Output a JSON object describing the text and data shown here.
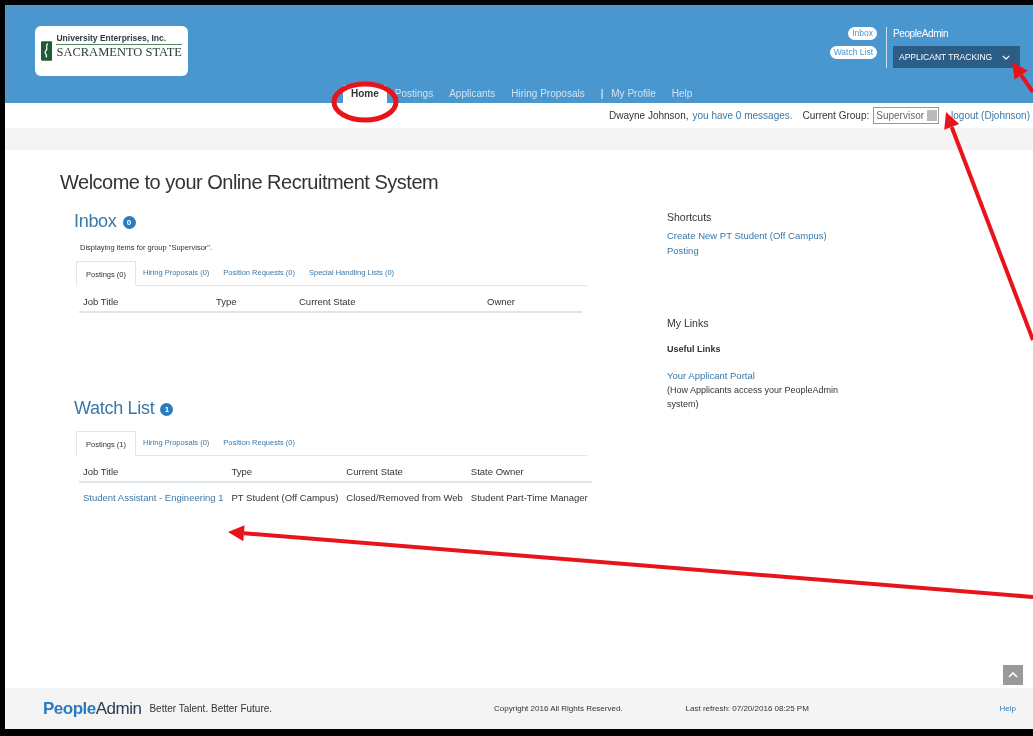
{
  "header": {
    "logo": {
      "line_1": "University Enterprises, Inc.",
      "line_2": "SACRAMENTO STATE"
    },
    "quick_links": [
      "Inbox",
      "Watch List"
    ],
    "product": "PeopleAdmin",
    "module_menu": "APPLICANT TRACKING",
    "nav": [
      {
        "kind": "tab",
        "label": "Home",
        "selected": true
      },
      {
        "kind": "tab",
        "label": "Postings",
        "selected": false
      },
      {
        "kind": "tab",
        "label": "Applicants",
        "selected": false
      },
      {
        "kind": "tab",
        "label": "Hiring Proposals",
        "selected": false
      },
      {
        "kind": "divider",
        "label": "|"
      },
      {
        "kind": "tab",
        "label": "My Profile",
        "selected": false
      },
      {
        "kind": "tab",
        "label": "Help",
        "selected": false
      }
    ]
  },
  "user_bar": {
    "user": "Dwayne Johnson,",
    "messages": "you have 0 messages.",
    "group_label": "Current Group:",
    "group_value": "Supervisor",
    "logout": "logout (Djohnson)"
  },
  "title": "Welcome to your Online Recruitment System",
  "inbox": {
    "title": "Inbox",
    "count": "0",
    "note": "Displaying items for group \"Supervisor\".",
    "tabs": [
      {
        "label": "Postings (0)",
        "selected": true
      },
      {
        "label": "Hiring Proposals (0)",
        "selected": false
      },
      {
        "label": "Position Requests (0)",
        "selected": false
      },
      {
        "label": "Special Handling Lists (0)",
        "selected": false
      }
    ],
    "columns": [
      "Job Title",
      "Type",
      "Current State",
      "Owner"
    ]
  },
  "watch_list": {
    "title": "Watch List",
    "count": "1",
    "tabs": [
      {
        "label": "Postings (1)",
        "selected": true
      },
      {
        "label": "Hiring Proposals (0)",
        "selected": false
      },
      {
        "label": "Position Requests (0)",
        "selected": false
      }
    ],
    "columns": [
      "Job Title",
      "Type",
      "Current State",
      "State Owner"
    ],
    "rows": [
      [
        "Student Assistant - Engineering 1",
        "PT Student (Off Campus)",
        "Closed/Removed from Web",
        "Student Part-Time Manager"
      ]
    ]
  },
  "shortcuts": {
    "title": "Shortcuts",
    "links": [
      "Create New PT Student (Off Campus) Posting"
    ]
  },
  "my_links": {
    "title": "My Links",
    "subtitle": "Useful Links",
    "link": "Your Applicant Portal",
    "note": "(How Applicants access your PeopleAdmin system)"
  },
  "footer": {
    "brand": "**People**Admin",
    "tagline": "Better Talent. Better Future.",
    "copyright": "Copyright 2016 All Rights Reserved.",
    "refresh": "Last refresh: 07/20/2016 08:25 PM",
    "help": "Help"
  },
  "annotations": [
    {
      "kind": "circle"
    },
    {
      "kind": "arrow"
    },
    {
      "kind": "arrow"
    },
    {
      "kind": "arrow"
    }
  ]
}
